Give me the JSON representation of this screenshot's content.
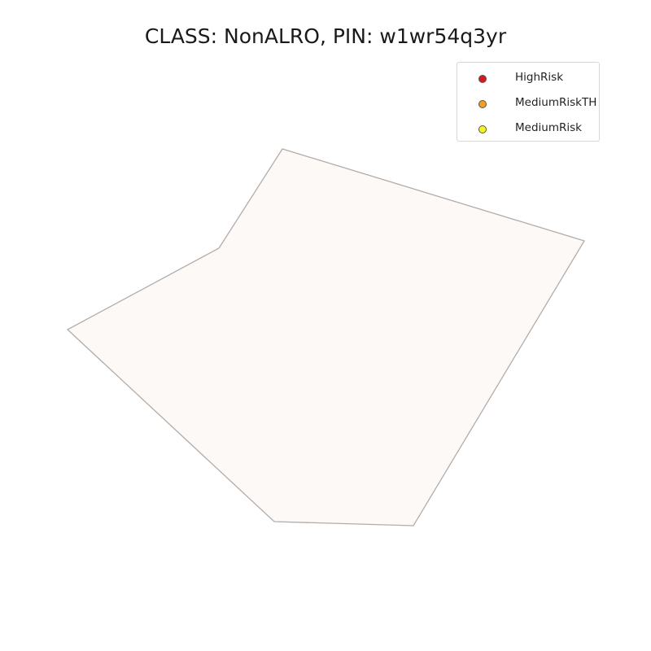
{
  "map": {
    "title": "CLASS: NonALRO, PIN: w1wr54q3yr",
    "parcel": {
      "fill": "#fdf9f6",
      "stroke": "#b3aca8"
    }
  },
  "legend": {
    "items": [
      {
        "label": "HighRisk",
        "color": "#d7191c"
      },
      {
        "label": "MediumRiskTH",
        "color": "#f59d1f"
      },
      {
        "label": "MediumRisk",
        "color": "#f5f51d"
      }
    ]
  }
}
